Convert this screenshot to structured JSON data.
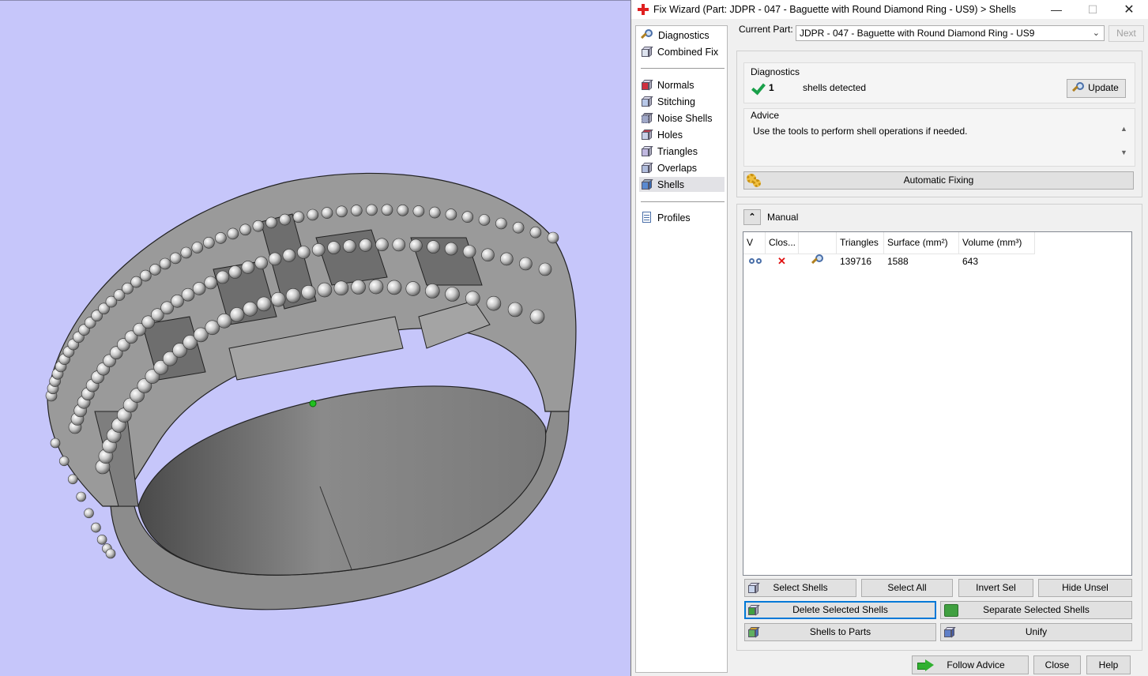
{
  "window": {
    "title": "Fix Wizard (Part: JDPR - 047 - Baguette with Round Diamond  Ring - US9) > Shells",
    "minimize_glyph": "—",
    "maximize_glyph": "☐",
    "close_glyph": "✕"
  },
  "nav": {
    "items": [
      {
        "label": "Diagnostics",
        "icon": "magnifier-icon"
      },
      {
        "label": "Combined Fix",
        "icon": "cube-icon"
      },
      {
        "label": "Normals",
        "icon": "normals-cube-icon"
      },
      {
        "label": "Stitching",
        "icon": "stitching-cube-icon"
      },
      {
        "label": "Noise Shells",
        "icon": "noise-shells-icon"
      },
      {
        "label": "Holes",
        "icon": "holes-cube-icon"
      },
      {
        "label": "Triangles",
        "icon": "triangles-cube-icon"
      },
      {
        "label": "Overlaps",
        "icon": "overlaps-cube-icon"
      },
      {
        "label": "Shells",
        "icon": "shells-cube-icon",
        "selected": true
      },
      {
        "label": "Profiles",
        "icon": "document-icon"
      }
    ]
  },
  "current_part": {
    "label": "Current Part:",
    "value": "JDPR - 047 - Baguette with Round Diamond  Ring - US9",
    "next_label": "Next"
  },
  "diagnostics": {
    "caption": "Diagnostics",
    "count": "1",
    "text": "shells detected",
    "update_label": "Update",
    "advice_caption": "Advice",
    "advice_text": "Use the tools to perform shell operations if needed.",
    "automatic_fixing_label": "Automatic Fixing"
  },
  "manual": {
    "label": "Manual",
    "table": {
      "columns": [
        "V",
        "Clos...",
        "",
        "Triangles",
        "Surface (mm²)",
        "Volume (mm³)"
      ],
      "rows": [
        {
          "triangles": "139716",
          "surface": "1588",
          "volume": "643",
          "closed": "✕"
        }
      ]
    },
    "buttons": {
      "select_shells": "Select Shells",
      "select_all": "Select All",
      "invert_sel": "Invert Sel",
      "hide_unsel": "Hide Unsel",
      "delete_selected_shells": "Delete Selected Shells",
      "separate_selected_shells": "Separate Selected Shells",
      "shells_to_parts": "Shells to Parts",
      "unify": "Unify"
    }
  },
  "footer": {
    "follow_advice": "Follow Advice",
    "close": "Close",
    "help": "Help"
  },
  "colors": {
    "viewport_bg": "#c6c6fa",
    "ring_gray": "#8e8e8e",
    "accent_check": "#1aa04a",
    "error_red": "#e01010"
  }
}
